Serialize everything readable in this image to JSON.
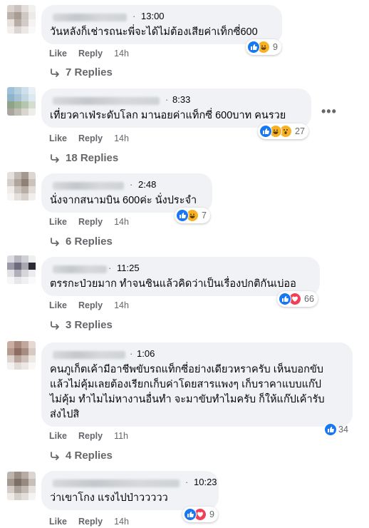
{
  "comments": [
    {
      "time": "13:00",
      "text": "วันหลังก็เช่ารถนะพี่จะได้ไม่ต้องเสียค่าเท็กซี่600",
      "reaction_count": "9",
      "reactions": [
        "like-icon",
        "haha-icon"
      ],
      "like_label": "Like",
      "reply_label": "Reply",
      "age": "14h",
      "replies_label": "7 Replies"
    },
    {
      "time": "8:33",
      "text": "เที่ยวคาเฟ่ระดับโลก มานอยค่าแท็กซี่ 600บาท คนรวย",
      "reaction_count": "27",
      "reactions": [
        "like-icon",
        "haha-icon",
        "wow-icon"
      ],
      "like_label": "Like",
      "reply_label": "Reply",
      "age": "14h",
      "replies_label": "18 Replies"
    },
    {
      "time": "2:48",
      "text": "นั่งจากสนามบิน 600ค่ะ นั่งประจำ",
      "reaction_count": "7",
      "reactions": [
        "like-icon",
        "haha-icon"
      ],
      "like_label": "Like",
      "reply_label": "Reply",
      "age": "14h",
      "replies_label": "6 Replies"
    },
    {
      "time": "11:25",
      "text": "ตรรกะป่วยมาก ทำจนชินแล้วคิดว่าเป็นเรื่องปกติกันเบ่ออ",
      "reaction_count": "66",
      "reactions": [
        "like-icon",
        "love-icon"
      ],
      "like_label": "Like",
      "reply_label": "Reply",
      "age": "14h",
      "replies_label": "3 Replies"
    },
    {
      "time": "1:06",
      "text": "คนภูเก็ตเค้ามีอาชีพขับรถแท็กซี่อย่างเดียวหราครับ เห็นบอกขับ\nแล้วไม่คุ้มเลยต้องเรียกเก็บค่าโดยสารแพงๆ เก็บราคาแบบแก๊ป\nไม่คุ้ม ทำไมไม่หางานอื่นทำ จะมาขับทำไมครับ ก็ให้แก๊ปเค้ารับ\nส่งไปสิ",
      "reaction_count": "34",
      "reactions": [
        "like-icon"
      ],
      "like_label": "Like",
      "reply_label": "Reply",
      "age": "11h",
      "replies_label": "4 Replies"
    },
    {
      "time": "10:23",
      "text": "ว่าเขาโกง แรงไปป่าววววว",
      "reaction_count": "9",
      "reactions": [
        "like-icon",
        "love-icon"
      ],
      "like_label": "Like",
      "reply_label": "Reply",
      "age": "14h"
    }
  ],
  "more_label": "•••",
  "colors": {
    "like": "#1877f2",
    "love": "#f33e58",
    "haha": "#f7b125",
    "bubble": "#f0f2f5",
    "meta": "#65676b"
  }
}
